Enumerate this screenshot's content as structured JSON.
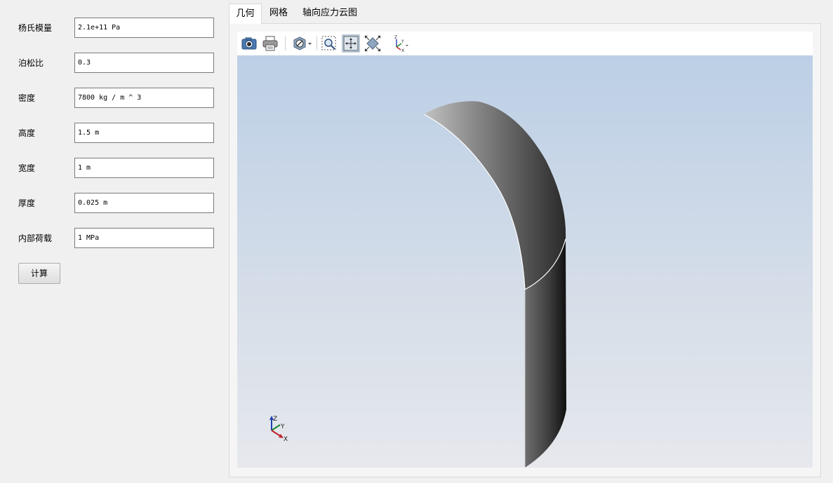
{
  "form": {
    "fields": [
      {
        "label": "杨氏模量",
        "value": "2.1e+11 Pa"
      },
      {
        "label": "泊松比",
        "value": "0.3"
      },
      {
        "label": "密度",
        "value": "7800 kg / m ^ 3"
      },
      {
        "label": "高度",
        "value": "1.5 m"
      },
      {
        "label": "宽度",
        "value": "1 m"
      },
      {
        "label": "厚度",
        "value": "0.025 m"
      },
      {
        "label": "内部荷载",
        "value": "1 MPa"
      }
    ],
    "calculate_label": "计算"
  },
  "tabs": [
    {
      "label": "几何",
      "active": true
    },
    {
      "label": "网格",
      "active": false
    },
    {
      "label": "轴向应力云图",
      "active": false
    }
  ],
  "toolbar": {
    "icons": [
      "camera-icon",
      "print-icon",
      "hide-icon",
      "zoom-box-icon",
      "fit-view-icon",
      "fit-all-icon",
      "axes-orient-icon"
    ]
  },
  "viewport": {
    "triad": {
      "x": "X",
      "y": "Y",
      "z": "Z"
    },
    "colors": {
      "x": "#c0202a",
      "y": "#1e8a2a",
      "z": "#1f3fb0"
    },
    "background_top": "#bccfe6",
    "background_bottom": "#e6e8ed"
  }
}
